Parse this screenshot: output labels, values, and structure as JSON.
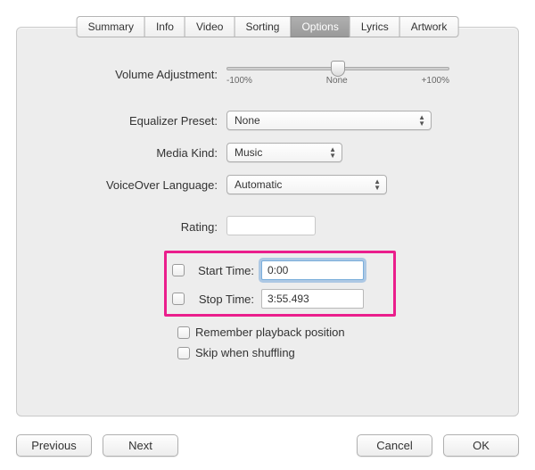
{
  "tabs": {
    "summary": "Summary",
    "info": "Info",
    "video": "Video",
    "sorting": "Sorting",
    "options": "Options",
    "lyrics": "Lyrics",
    "artwork": "Artwork"
  },
  "labels": {
    "volume_adjustment": "Volume Adjustment:",
    "equalizer_preset": "Equalizer Preset:",
    "media_kind": "Media Kind:",
    "voiceover_language": "VoiceOver Language:",
    "rating": "Rating:",
    "start_time": "Start Time:",
    "stop_time": "Stop Time:",
    "remember_playback": "Remember playback position",
    "skip_shuffling": "Skip when shuffling"
  },
  "values": {
    "equalizer_preset": "None",
    "media_kind": "Music",
    "voiceover_language": "Automatic",
    "start_time": "0:00",
    "stop_time": "3:55.493"
  },
  "slider": {
    "min_label": "-100%",
    "mid_label": "None",
    "max_label": "+100%"
  },
  "buttons": {
    "previous": "Previous",
    "next": "Next",
    "cancel": "Cancel",
    "ok": "OK"
  }
}
